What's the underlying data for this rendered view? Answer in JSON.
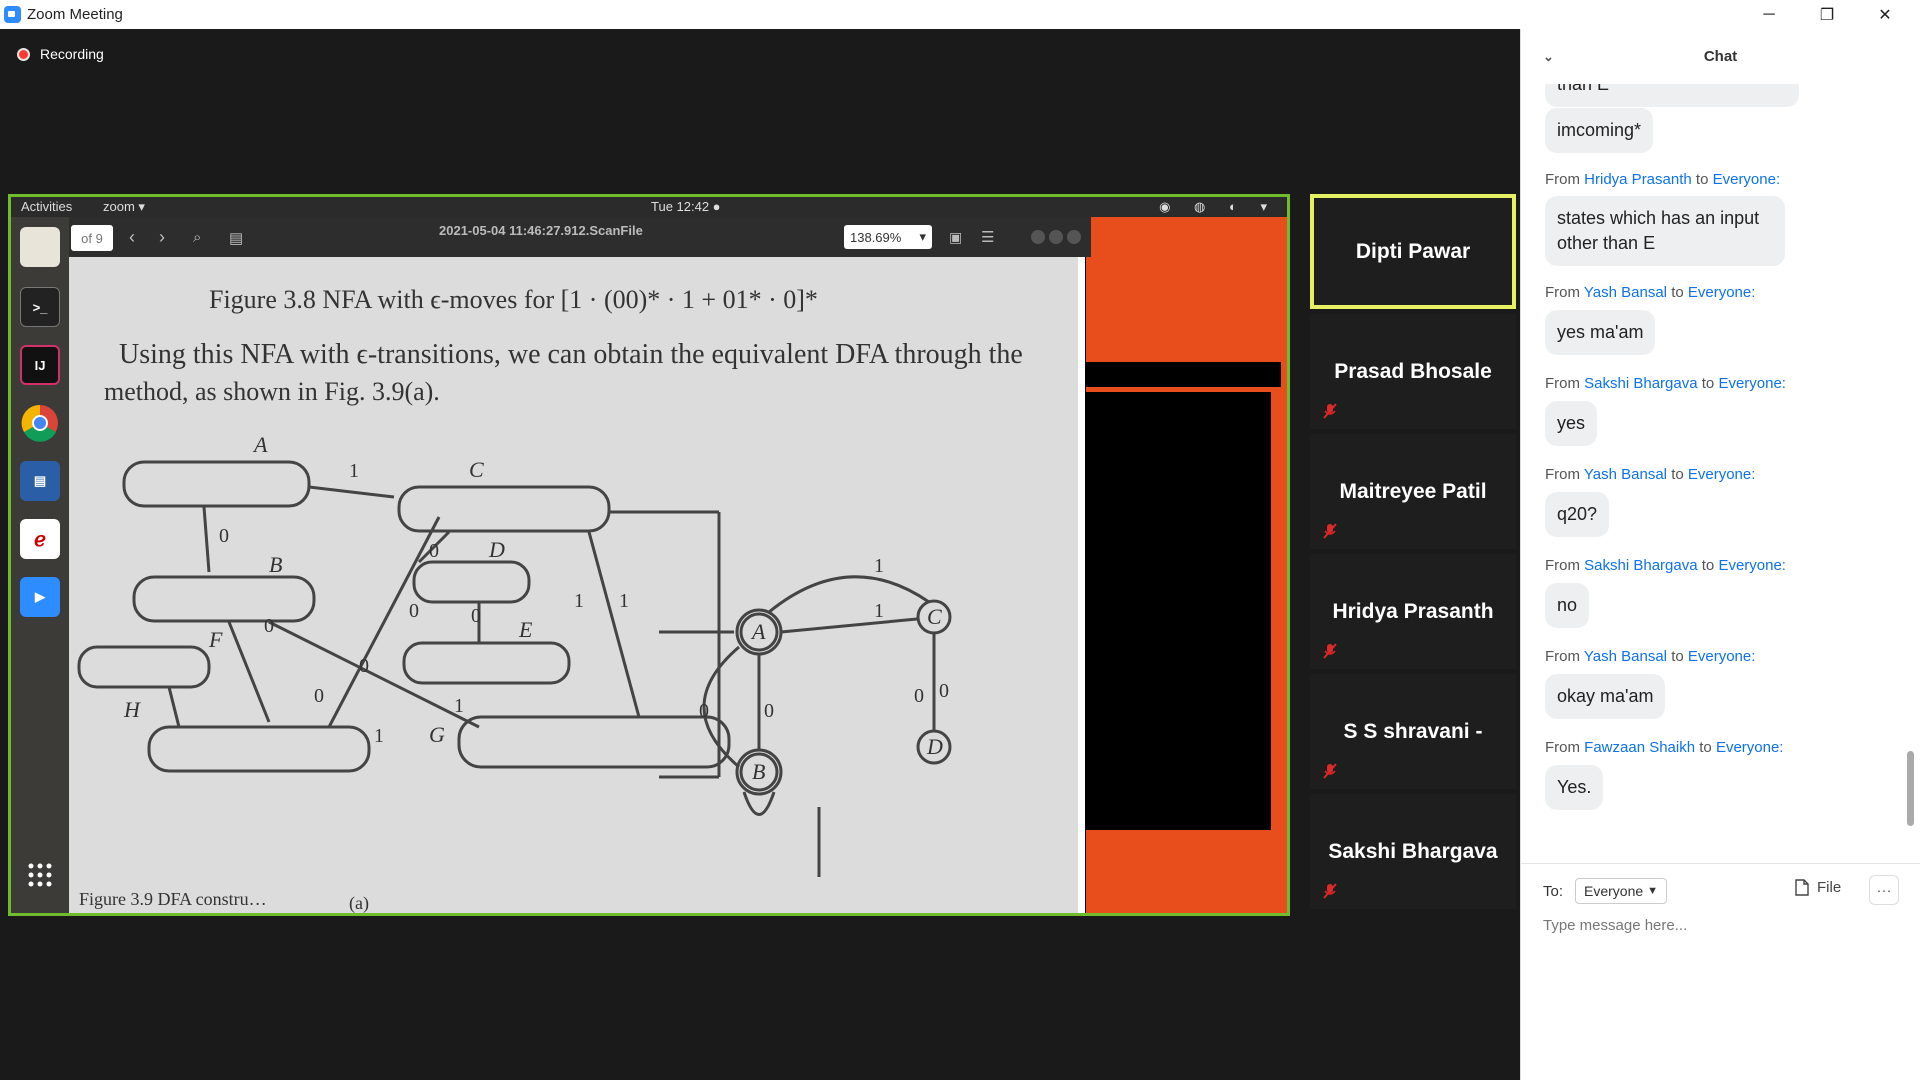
{
  "window": {
    "title": "Zoom Meeting",
    "minimize": "─",
    "restore": "❐",
    "close": "✕"
  },
  "recording": {
    "label": "Recording"
  },
  "shared_screen": {
    "topbar": {
      "activities": "Activities",
      "app": "zoom ▾",
      "clock": "Tue 12:42 ●",
      "tray": "◉ ◍ ◐ ▾"
    },
    "viewer": {
      "page_indicator": "of 9",
      "filename": "2021-05-04 11:46:27.912.ScanFile",
      "zoom": "138.69%",
      "figure_title": "Figure 3.8    NFA with ϵ-moves for [1 · (00)* · 1 + 01* · 0]*",
      "body_text_1": "Using this NFA with ϵ-transitions, we can obtain the equivalent DFA through the",
      "body_text_2": "method, as shown in Fig. 3.9(a).",
      "caption": "Figure 3.9   DFA constru…",
      "caption_sub": "(a)"
    }
  },
  "participants": [
    {
      "name": "Dipti Pawar",
      "active": true,
      "muted": false
    },
    {
      "name": "Prasad Bhosale",
      "active": false,
      "muted": true
    },
    {
      "name": "Maitreyee Patil",
      "active": false,
      "muted": true
    },
    {
      "name": "Hridya Prasanth",
      "active": false,
      "muted": true
    },
    {
      "name": "S S shravani -",
      "active": false,
      "muted": true
    },
    {
      "name": "Sakshi Bhargava",
      "active": false,
      "muted": true
    }
  ],
  "chat": {
    "title": "Chat",
    "partial_message": "than E",
    "messages": [
      {
        "text": "imcoming*"
      },
      {
        "from": "Hridya Prasanth",
        "to": "Everyone:",
        "text": "states which has an input other than E"
      },
      {
        "from": "Yash Bansal",
        "to": "Everyone:",
        "text": "yes ma'am"
      },
      {
        "from": "Sakshi Bhargava",
        "to": "Everyone:",
        "text": "yes"
      },
      {
        "from": "Yash Bansal",
        "to": "Everyone:",
        "text": "q20?"
      },
      {
        "from": "Sakshi Bhargava",
        "to": "Everyone:",
        "text": "no"
      },
      {
        "from": "Yash Bansal",
        "to": "Everyone:",
        "text": "okay ma'am"
      },
      {
        "from": "Fawzaan Shaikh",
        "to": "Everyone:",
        "text": "Yes."
      }
    ],
    "from_word": "From",
    "to_word": "to",
    "to_label": "To:",
    "recipient": "Everyone",
    "file_label": "File",
    "more_label": "···",
    "input_placeholder": "Type message here..."
  }
}
